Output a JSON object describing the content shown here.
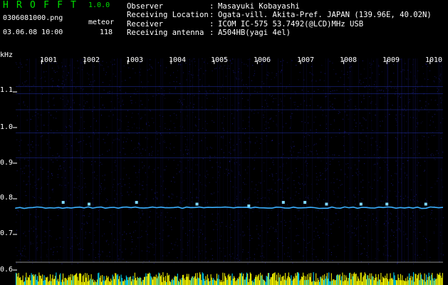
{
  "header": {
    "app_title": "HROFFT",
    "app_version": "1.0.0",
    "file_name": "0306081000.png",
    "datetime": "03.06.08 10:00",
    "meteor_label": "meteor",
    "meteor_count": "118"
  },
  "info": [
    {
      "label": "Observer",
      "sep": ":",
      "value": "Masayuki Kobayashi"
    },
    {
      "label": "Receiving Location",
      "sep": ":",
      "value": "Ogata-vill. Akita-Pref. JAPAN (139.96E, 40.02N)"
    },
    {
      "label": "Receiver",
      "sep": ":",
      "value": "ICOM IC-575 53.7492(@LCD)MHz USB"
    },
    {
      "label": "Receiving antenna",
      "sep": ":",
      "value": "A504HB(yagi 4el)"
    }
  ],
  "axes": {
    "y_unit": "kHz",
    "y_ticks": [
      "1.1",
      "1.0",
      "0.9",
      "0.8",
      "0.7",
      "0.6"
    ],
    "x_ticks": [
      "1001",
      "1002",
      "1003",
      "1004",
      "1005",
      "1006",
      "1007",
      "1008",
      "1009",
      "1010"
    ]
  },
  "colors": {
    "background": "#000000",
    "title": "#00e000",
    "text": "#ffffff",
    "noise": "#1a1a8a",
    "trace": "#3ab0ff",
    "level_yellow": "#ffff00",
    "level_cyan": "#00e0ff"
  },
  "chart_data": {
    "type": "heatmap",
    "x_ticks": [
      "1001",
      "1002",
      "1003",
      "1004",
      "1005",
      "1006",
      "1007",
      "1008",
      "1009",
      "1010"
    ],
    "y_ticks": [
      1.1,
      1.0,
      0.9,
      0.8,
      0.7,
      0.6
    ],
    "ylabel": "kHz",
    "ylim": [
      0.59,
      1.17
    ],
    "trace_freq_khz": 0.775,
    "meteor_events": [
      {
        "minute": 1001.5,
        "khz": 0.79
      },
      {
        "minute": 1002.1,
        "khz": 0.785
      },
      {
        "minute": 1003.2,
        "khz": 0.79
      },
      {
        "minute": 1004.6,
        "khz": 0.785
      },
      {
        "minute": 1005.8,
        "khz": 0.78
      },
      {
        "minute": 1006.6,
        "khz": 0.79
      },
      {
        "minute": 1007.1,
        "khz": 0.79
      },
      {
        "minute": 1007.6,
        "khz": 0.785
      },
      {
        "minute": 1008.4,
        "khz": 0.785
      },
      {
        "minute": 1009.0,
        "khz": 0.785
      },
      {
        "minute": 1009.9,
        "khz": 0.785
      }
    ]
  }
}
